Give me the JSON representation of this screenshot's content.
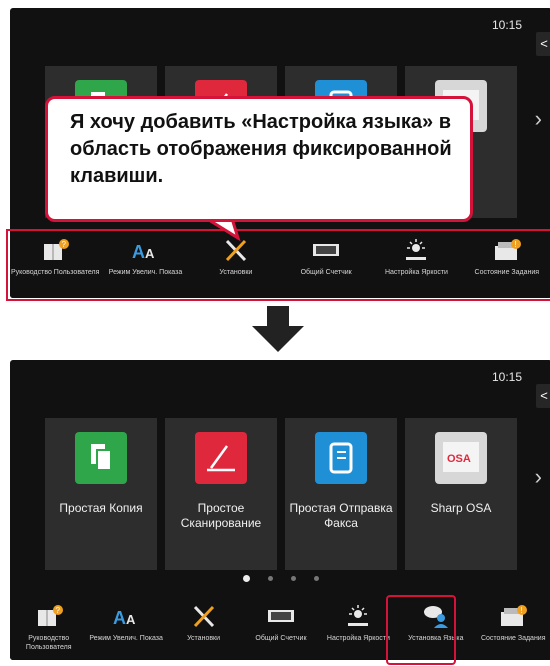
{
  "clock": "10:15",
  "collapse_tab": "<",
  "next_arrow": "›",
  "callout_text": "Я хочу добавить «Настройка языка» в область отображения фиксированной клавиши.",
  "tiles": [
    {
      "label": "Простая Копия",
      "icon": "copy-icon",
      "color": "#2fa64a"
    },
    {
      "label": "Простое Сканирование",
      "icon": "scan-icon",
      "color": "#e0283d"
    },
    {
      "label": "Простая Отправка Факса",
      "icon": "fax-icon",
      "color": "#1f8fd6"
    },
    {
      "label": "Sharp OSA",
      "icon": "sharp-osa-icon",
      "color": "#d7d7d7"
    }
  ],
  "bar_top": [
    {
      "label": "Руководство Пользователя",
      "icon": "user-guide-icon"
    },
    {
      "label": "Режим Увелич. Показа",
      "icon": "enlarge-display-icon"
    },
    {
      "label": "Установки",
      "icon": "settings-tools-icon"
    },
    {
      "label": "Общий Счетчик",
      "icon": "counter-icon"
    },
    {
      "label": "Настройка Яркости",
      "icon": "brightness-icon"
    },
    {
      "label": "Состояние Задания",
      "icon": "job-status-icon"
    }
  ],
  "bar_bottom": [
    {
      "label": "Руководство Пользователя",
      "icon": "user-guide-icon"
    },
    {
      "label": "Режим Увелич. Показа",
      "icon": "enlarge-display-icon"
    },
    {
      "label": "Установки",
      "icon": "settings-tools-icon"
    },
    {
      "label": "Общий Счетчик",
      "icon": "counter-icon"
    },
    {
      "label": "Настройка Яркости",
      "icon": "brightness-icon"
    },
    {
      "label": "Установка Языка",
      "icon": "language-setting-icon"
    },
    {
      "label": "Состояние Задания",
      "icon": "job-status-icon"
    }
  ],
  "colors": {
    "highlight": "#d5133a",
    "screen": "#111111",
    "tile": "#2d2d2d"
  }
}
